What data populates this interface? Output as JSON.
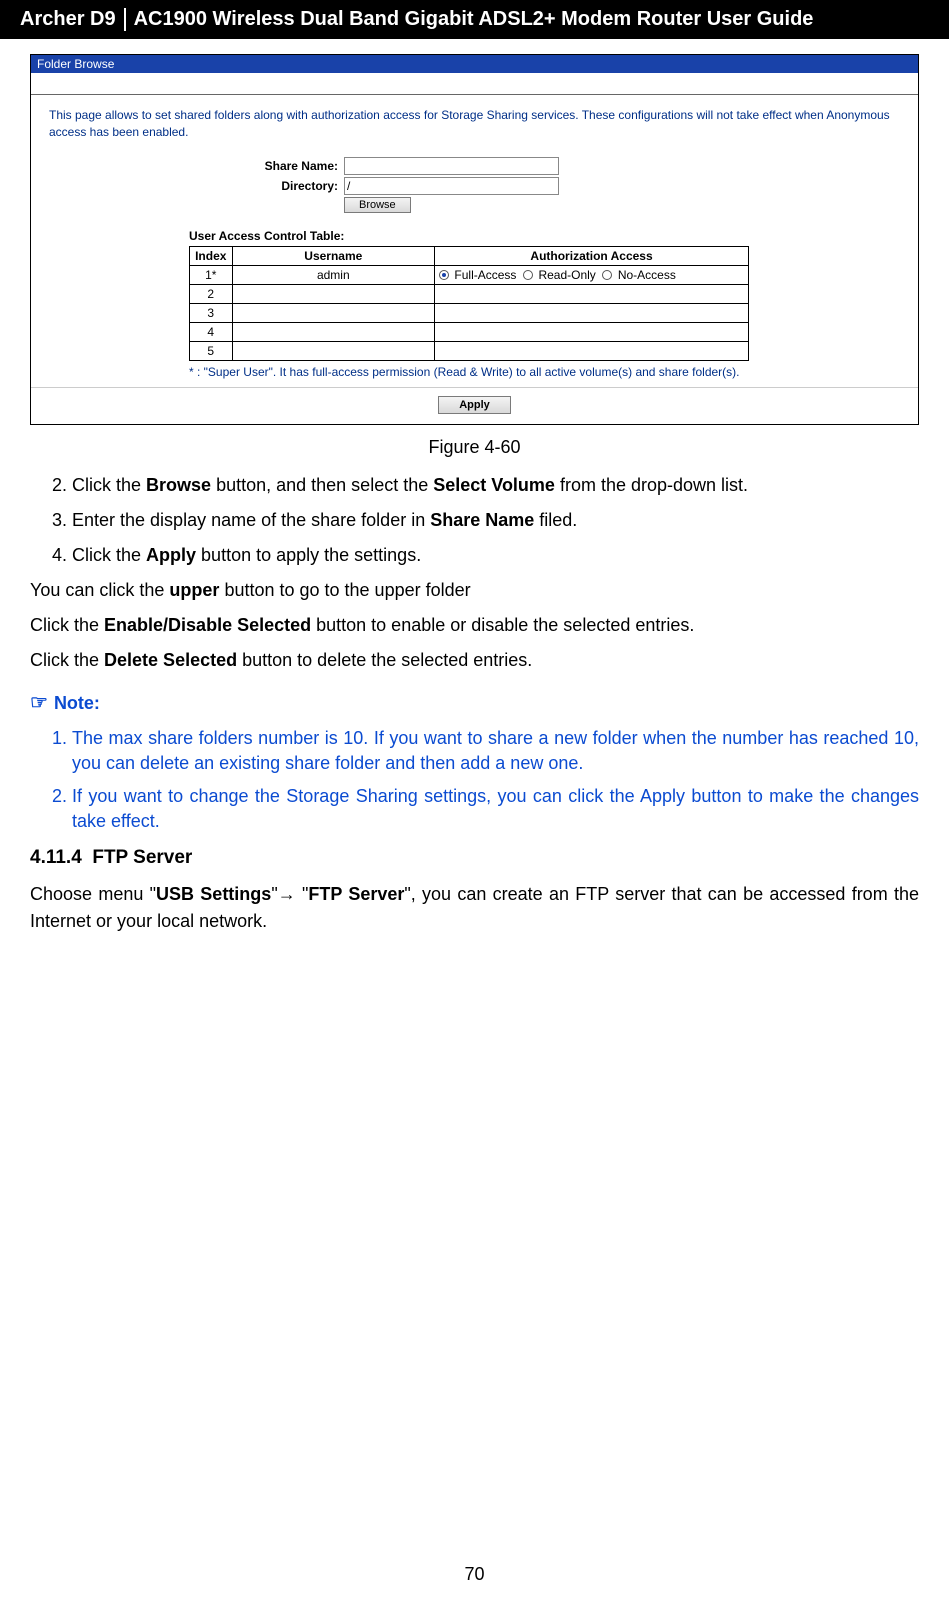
{
  "header": {
    "model": "Archer D9",
    "title": "AC1900 Wireless Dual Band Gigabit ADSL2+ Modem Router User Guide"
  },
  "panel": {
    "window_title": "Folder Browse",
    "description": "This page allows to set shared folders along with authorization access for Storage Sharing services. These configurations will not take effect when Anonymous access has been enabled.",
    "share_name_label": "Share Name:",
    "share_name_value": "",
    "directory_label": "Directory:",
    "directory_value": "/",
    "browse_btn": "Browse",
    "uac_table_label": "User Access Control Table:",
    "table": {
      "headers": {
        "index": "Index",
        "username": "Username",
        "auth": "Authorization Access"
      },
      "auth_options": {
        "full": "Full-Access",
        "read": "Read-Only",
        "none": "No-Access"
      },
      "rows": [
        {
          "index": "1*",
          "username": "admin",
          "auth": "Full-Access"
        },
        {
          "index": "2",
          "username": "",
          "auth": ""
        },
        {
          "index": "3",
          "username": "",
          "auth": ""
        },
        {
          "index": "4",
          "username": "",
          "auth": ""
        },
        {
          "index": "5",
          "username": "",
          "auth": ""
        }
      ]
    },
    "super_note": "* : \"Super User\". It has full-access permission (Read & Write) to all active volume(s) and share folder(s).",
    "apply_btn": "Apply"
  },
  "figure_caption": "Figure 4-60",
  "steps": {
    "s2": {
      "pre": "Click the ",
      "b1": "Browse",
      "mid": " button, and then select the ",
      "b2": "Select Volume",
      "post": " from the drop-down list."
    },
    "s3": {
      "pre": "Enter the display name of the share folder in ",
      "b1": "Share Name",
      "post": " filed."
    },
    "s4": {
      "pre": "Click the ",
      "b1": "Apply",
      "post": " button to apply the settings."
    }
  },
  "lines": {
    "upper": {
      "pre": "You can click the ",
      "b1": "upper",
      "post": " button to go to the upper folder"
    },
    "enable": {
      "pre": "Click the ",
      "b1": "Enable/Disable Selected",
      "post": " button to enable or disable the selected entries."
    },
    "delete": {
      "pre": "Click the ",
      "b1": "Delete Selected",
      "post": " button to delete the selected entries."
    }
  },
  "note_heading": "Note:",
  "notes": {
    "n1": "The max share folders number is 10. If you want to share a new folder when the number has reached 10, you can delete an existing share folder and then add a new one.",
    "n2": "If you want to change the Storage Sharing settings, you can click the Apply button to make the changes take effect."
  },
  "section": {
    "num": "4.11.4",
    "title": "FTP Server"
  },
  "section_body": {
    "pre": "Choose menu \"",
    "b1": "USB Settings",
    "mid": "\"→ \"",
    "b2": "FTP Server",
    "post": "\", you can create an FTP server that can be accessed from the Internet or your local network."
  },
  "page_number": "70"
}
